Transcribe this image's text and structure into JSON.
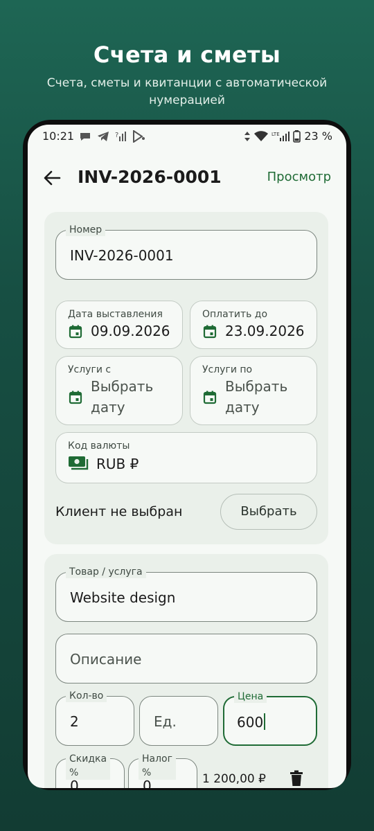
{
  "promo": {
    "title": "Счета и сметы",
    "subtitle": "Счета, сметы и квитанции с автоматической нумерацией"
  },
  "status_bar": {
    "time": "10:21",
    "battery_pct": "23 %"
  },
  "app_bar": {
    "title": "INV-2026-0001",
    "preview_label": "Просмотр"
  },
  "invoice": {
    "number_label": "Номер",
    "number_value": "INV-2026-0001",
    "issue_date_label": "Дата выставления",
    "issue_date_value": "09.09.2026",
    "due_date_label": "Оплатить до",
    "due_date_value": "23.09.2026",
    "services_from_label": "Услуги с",
    "services_from_value_line1": "Выбрать",
    "services_from_value_line2": "дату",
    "services_to_label": "Услуги по",
    "services_to_value_line1": "Выбрать",
    "services_to_value_line2": "дату",
    "currency_label": "Код валюты",
    "currency_value": "RUB ₽",
    "client_status": "Клиент не выбран",
    "choose_client_button": "Выбрать"
  },
  "line_item": {
    "product_label": "Товар / услуга",
    "product_value": "Website design",
    "description_placeholder": "Описание",
    "qty_label": "Кол-во",
    "qty_value": "2",
    "unit_placeholder": "Ед.",
    "price_label": "Цена",
    "price_value": "600",
    "discount_label_line1": "Скидка",
    "discount_label_line2": "%",
    "discount_value": "0",
    "tax_label_line1": "Налог",
    "tax_label_line2": "%",
    "tax_value": "0",
    "line_total": "1 200,00 ₽"
  },
  "colors": {
    "accent": "#1f6b35",
    "background_gradient_top": "#1e6654",
    "background_gradient_bottom": "#123c33",
    "surface": "#f6f9f6",
    "card": "#eaf0ea"
  },
  "icons": [
    "arrow-back-icon",
    "calendar-icon",
    "cash-icon",
    "trash-icon",
    "wifi-icon",
    "signal-icon",
    "battery-icon",
    "chat-icon",
    "telegram-icon",
    "play-store-icon"
  ]
}
